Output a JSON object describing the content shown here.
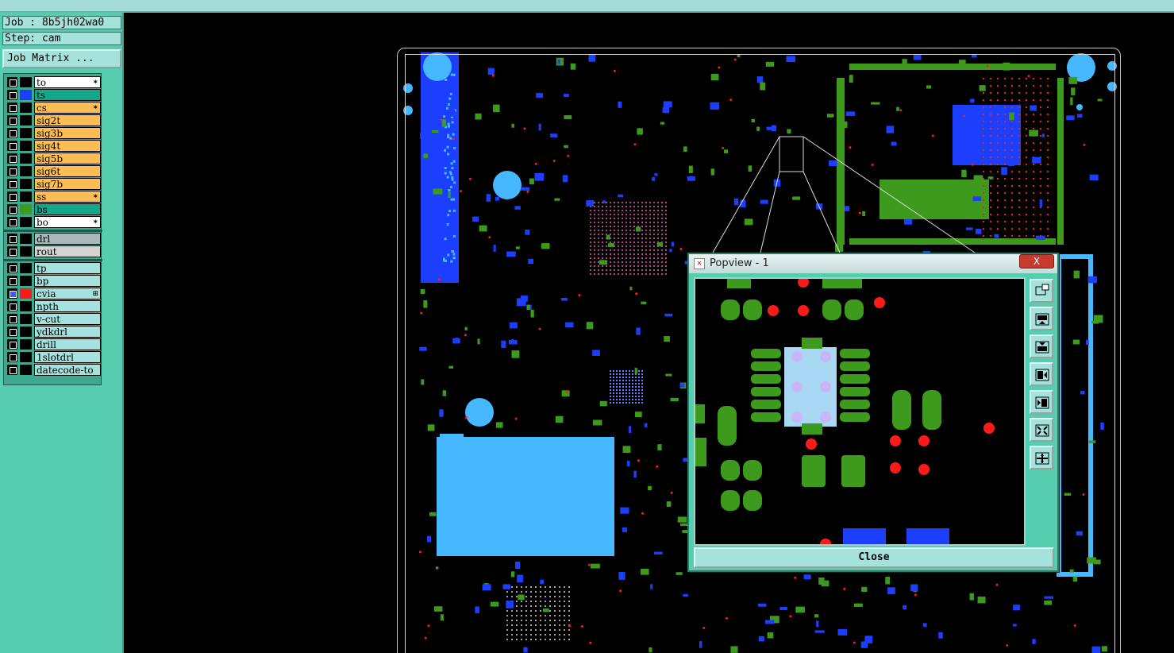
{
  "job_label": "Job : 8b5jh02wa0",
  "step_label": "Step: cam",
  "job_matrix_button": "Job Matrix ...",
  "layers": [
    {
      "name": "to",
      "bg": "#ffffff",
      "swatch": "#000000",
      "mark": "✶",
      "checked": false
    },
    {
      "name": "ts",
      "bg": "#13a88a",
      "swatch": "#1c3fff",
      "mark": "",
      "checked": false
    },
    {
      "name": "cs",
      "bg": "#ffbe55",
      "swatch": "#000000",
      "mark": "✶",
      "checked": false
    },
    {
      "name": "sig2t",
      "bg": "#ffbe55",
      "swatch": "#000000",
      "mark": "",
      "checked": false
    },
    {
      "name": "sig3b",
      "bg": "#ffbe55",
      "swatch": "#000000",
      "mark": "",
      "checked": false
    },
    {
      "name": "sig4t",
      "bg": "#ffbe55",
      "swatch": "#000000",
      "mark": "",
      "checked": false
    },
    {
      "name": "sig5b",
      "bg": "#ffbe55",
      "swatch": "#000000",
      "mark": "",
      "checked": false
    },
    {
      "name": "sig6t",
      "bg": "#ffbe55",
      "swatch": "#000000",
      "mark": "",
      "checked": false
    },
    {
      "name": "sig7b",
      "bg": "#ffbe55",
      "swatch": "#000000",
      "mark": "",
      "checked": false
    },
    {
      "name": "ss",
      "bg": "#ffbe55",
      "swatch": "#000000",
      "mark": "✶",
      "checked": false
    },
    {
      "name": "bs",
      "bg": "#13a88a",
      "swatch": "#3e9a1c",
      "mark": "",
      "checked": false
    },
    {
      "name": "bo",
      "bg": "#ffffff",
      "swatch": "#000000",
      "mark": "✶",
      "checked": false
    },
    {
      "name": "drl",
      "bg": "#a8b8bc",
      "swatch": "#000000",
      "mark": "",
      "checked": false,
      "sep": true
    },
    {
      "name": "rout",
      "bg": "#d4d4d4",
      "swatch": "#000000",
      "mark": "",
      "checked": false
    },
    {
      "name": "tp",
      "bg": "#a6e2dc",
      "swatch": "#000000",
      "mark": "",
      "checked": false,
      "sep": true
    },
    {
      "name": "bp",
      "bg": "#a6e2dc",
      "swatch": "#000000",
      "mark": "",
      "checked": false
    },
    {
      "name": "cvia",
      "bg": "#a6e2dc",
      "swatch": "#ff1a1a",
      "mark": "⊞",
      "checked": true
    },
    {
      "name": "npth",
      "bg": "#a6e2dc",
      "swatch": "#000000",
      "mark": "",
      "checked": false
    },
    {
      "name": "v-cut",
      "bg": "#a6e2dc",
      "swatch": "#000000",
      "mark": "",
      "checked": false
    },
    {
      "name": "ydkdrl",
      "bg": "#a6e2dc",
      "swatch": "#000000",
      "mark": "",
      "checked": false
    },
    {
      "name": "drill",
      "bg": "#a6e2dc",
      "swatch": "#000000",
      "mark": "",
      "checked": false
    },
    {
      "name": "1slotdrl",
      "bg": "#a6e2dc",
      "swatch": "#000000",
      "mark": "",
      "checked": false
    },
    {
      "name": "datecode-to",
      "bg": "#a6e2dc",
      "swatch": "#000000",
      "mark": "",
      "checked": false
    }
  ],
  "popview": {
    "title": "Popview - 1",
    "close_x": "X",
    "close_button": "Close",
    "tools": [
      "zoom-reset-icon",
      "pan-up-icon",
      "pan-down-icon",
      "pan-left-icon",
      "pan-right-icon",
      "zoom-in-icon",
      "zoom-out-icon"
    ]
  },
  "colors": {
    "panel": "#56cdaf",
    "copper": "#3e9a1c",
    "mask": "#1c3fff",
    "pad_light": "#45b8ff",
    "via": "#ff1a1a"
  }
}
